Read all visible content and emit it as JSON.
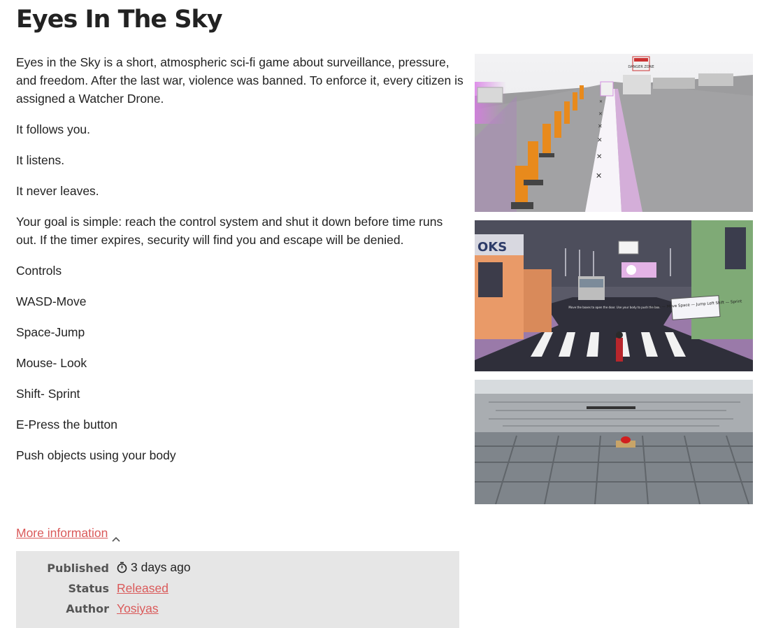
{
  "title": "Eyes In The Sky",
  "description": [
    "Eyes in the Sky is a short, atmospheric sci-fi game about surveillance, pressure, and freedom. After the last war, violence was banned. To enforce it, every citizen is assigned a Watcher Drone.",
    "It follows you.",
    "It listens.",
    "It never leaves.",
    "Your goal is simple: reach the control system and shut it down before time runs out.  If the timer expires, security will find you  and escape will be denied.",
    "Controls",
    "WASD-Move",
    "Space-Jump",
    "Mouse- Look",
    "Shift- Sprint",
    "E-Press the button",
    "Push objects using your body"
  ],
  "screenshots": {
    "shot1_sign": "DANGER ZONE",
    "shot2_store_sign": "OKS",
    "shot2_controls_sign": "WASD — Move Space — Jump Left Shift — Sprint",
    "shot2_hint": "Move the boxes to open the door. Use your body to push the box."
  },
  "more_info": {
    "label": "More information",
    "icon": "chevron-up-icon"
  },
  "info": {
    "published_label": "Published",
    "published_value": "3 days ago",
    "published_icon": "stopwatch-icon",
    "status_label": "Status",
    "status_value": "Released",
    "author_label": "Author",
    "author_value": "Yosiyas"
  },
  "colors": {
    "link": "#da5a5a",
    "panel": "#e6e6e6",
    "text": "#222222"
  }
}
